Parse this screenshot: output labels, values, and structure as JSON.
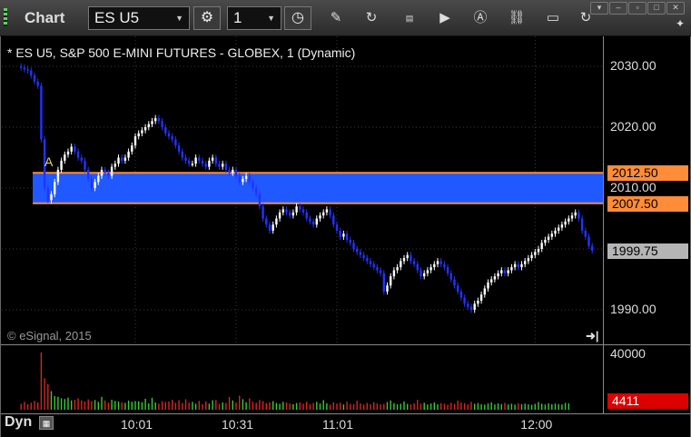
{
  "window": {
    "title": "Chart"
  },
  "toolbar": {
    "symbol": "ES U5",
    "interval": "1",
    "icons": [
      "gear-icon",
      "clock-icon",
      "pencil-icon",
      "refresh-icon",
      "ticker-icon",
      "play-icon",
      "alert-icon",
      "link-icon",
      "chat-icon",
      "twitter-icon"
    ]
  },
  "chart": {
    "title": "* ES U5, S&P 500 E-MINI FUTURES - GLOBEX, 1 (Dynamic)",
    "copyright": "© eSignal, 2015",
    "marker": "A",
    "scale": "Dyn",
    "volume_axis_label": "40000",
    "colors": {
      "band": "#1f59ff",
      "band_line": "#ff8c38",
      "up": "#ffffff",
      "down": "#2233ff",
      "vol_up": "#33cc33",
      "vol_down": "#dd2222",
      "last": "#b5b5b5",
      "vol_badge": "#dd0000"
    }
  },
  "chart_data": {
    "type": "candlestick",
    "y_ticks": [
      "2030.00",
      "2020.00",
      "2010.00",
      "1990.00"
    ],
    "x_ticks": [
      "10:01",
      "10:31",
      "11:01",
      "12:00"
    ],
    "x_tick_minutes": [
      0,
      30,
      60,
      119
    ],
    "first_bar_minute": -34,
    "band": {
      "upper": 2012.5,
      "lower": 2007.5,
      "upper_label": "2012.50",
      "lower_label": "2007.50"
    },
    "last_price": 1999.75,
    "last_price_label": "1999.75",
    "last_volume_label": "4411",
    "ylim": [
      1988,
      2033
    ],
    "closes": [
      2029.8,
      2029.5,
      2029.3,
      2028.5,
      2027.5,
      2026.8,
      2018,
      2010,
      2008,
      2009,
      2011,
      2013,
      2014.5,
      2015.5,
      2016,
      2016.8,
      2016,
      2015,
      2014.5,
      2013,
      2011.5,
      2010,
      2011,
      2012,
      2013,
      2012.5,
      2012,
      2013.5,
      2014,
      2015,
      2014.5,
      2015,
      2016,
      2017,
      2018.5,
      2019,
      2019.5,
      2020,
      2020.5,
      2021,
      2021.5,
      2021,
      2020,
      2019,
      2018.5,
      2018,
      2017,
      2016,
      2015,
      2014.5,
      2014,
      2014,
      2015,
      2014.5,
      2014,
      2013.5,
      2014.5,
      2015,
      2014,
      2013.5,
      2014,
      2013,
      2012.5,
      2013,
      2012,
      2011,
      2011.5,
      2012,
      2011,
      2010,
      2009,
      2007,
      2005,
      2004,
      2003,
      2004,
      2005,
      2006,
      2006.5,
      2006,
      2005.5,
      2006,
      2007,
      2006.5,
      2006,
      2005,
      2004.5,
      2004,
      2005,
      2005.5,
      2006,
      2006.5,
      2005.5,
      2004,
      2003,
      2002,
      2002.5,
      2001.5,
      2001,
      2000,
      1999.5,
      1999,
      1998.5,
      1998,
      1997.5,
      1997,
      1996.5,
      1996,
      1993,
      1994,
      1995.5,
      1996.5,
      1997,
      1998,
      1998.5,
      1999,
      1998,
      1997.5,
      1996.5,
      1995.5,
      1996,
      1996.5,
      1997,
      1997.5,
      1998,
      1997.5,
      1997,
      1996,
      1995,
      1994,
      1993,
      1992,
      1991,
      1990.5,
      1990,
      1991,
      1991.5,
      1992.5,
      1993.5,
      1994.5,
      1995,
      1995.5,
      1996,
      1996.5,
      1996,
      1996.5,
      1997,
      1997.5,
      1997,
      1997.5,
      1998,
      1998.5,
      1999,
      1999.5,
      2000,
      2001,
      2001.5,
      2002,
      2002.5,
      2003,
      2003.5,
      2004,
      2004.5,
      2005,
      2005.5,
      2006,
      2005,
      2003,
      2002,
      2000.5,
      1999.75
    ],
    "volumes": [
      4200,
      5600,
      3800,
      4900,
      6200,
      5100,
      40000,
      22000,
      18000,
      13000,
      9500,
      9000,
      8000,
      7500,
      8500,
      6500,
      7000,
      8000,
      6500,
      5800,
      7200,
      6000,
      6800,
      5500,
      9000,
      6500,
      5000,
      7000,
      6200,
      5800,
      5200,
      4800,
      6400,
      5600,
      6100,
      5900,
      5300,
      7700,
      4500,
      8400,
      5100,
      4300,
      6000,
      5500,
      5700,
      6900,
      4800,
      6600,
      4700,
      7300,
      5000,
      5500,
      4200,
      6200,
      3900,
      5800,
      4300,
      6600,
      6800,
      4100,
      5100,
      4700,
      8900,
      6500,
      5000,
      9800,
      7400,
      5200,
      8000,
      5600,
      4900,
      6800,
      6100,
      4600,
      5300,
      6000,
      4800,
      4200,
      5500,
      5100,
      4400,
      3900,
      4700,
      5200,
      4200,
      5600,
      3800,
      4700,
      5500,
      4400,
      6700,
      4600,
      3600,
      5100,
      4300,
      4900,
      3700,
      5600,
      4100,
      3900,
      6300,
      4500,
      3600,
      4800,
      3800,
      5300,
      4400,
      3800,
      4100,
      5400,
      6500,
      4600,
      3800,
      4200,
      5800,
      4100,
      3800,
      4600,
      6900,
      4300,
      4900,
      3700,
      4400,
      5100,
      3800,
      4600,
      4200,
      3500,
      4900,
      4100,
      6400,
      5000,
      4600,
      3700,
      5500,
      4200,
      4700,
      3900,
      3600,
      4400,
      5200,
      3700,
      4500,
      4000,
      4800,
      3700,
      4200,
      3600,
      4600,
      3900,
      4300,
      3800,
      3500,
      4100,
      5400,
      4200,
      3700,
      4500,
      3900,
      4300,
      4000,
      3700,
      4800,
      4411
    ]
  }
}
